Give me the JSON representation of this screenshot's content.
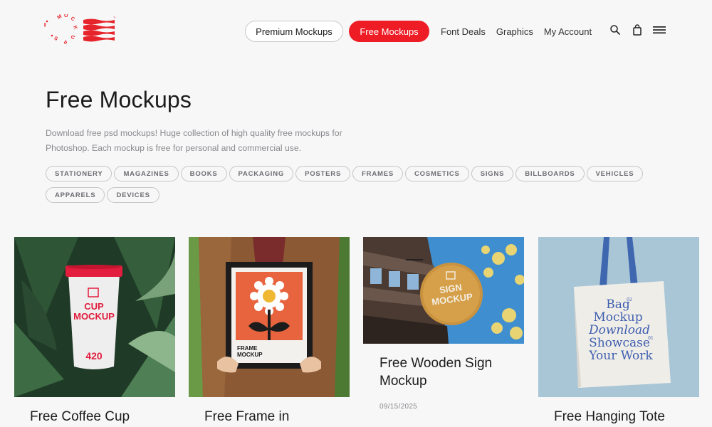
{
  "header": {
    "nav": {
      "premium_label": "Premium Mockups",
      "free_label": "Free Mockups",
      "links": [
        "Font Deals",
        "Graphics",
        "My Account"
      ]
    },
    "icons": [
      "search-icon",
      "shopping-bag-icon",
      "menu-icon"
    ]
  },
  "colors": {
    "accent": "#ee1c25",
    "background": "#f7f7f8",
    "muted_text": "#8a8a8e"
  },
  "intro": {
    "title": "Free Mockups",
    "description": "Download free psd mockups! Huge collection of high quality free mockups for Photoshop. Each mockup is free for personal and commercial use.",
    "tags": [
      "STATIONERY",
      "MAGAZINES",
      "BOOKS",
      "PACKAGING",
      "POSTERS",
      "FRAMES",
      "COSMETICS",
      "SIGNS",
      "BILLBOARDS",
      "VEHICLES",
      "APPARELS",
      "DEVICES"
    ]
  },
  "cards": [
    {
      "title": "Free Coffee Cup",
      "image_text": [
        "CUP",
        "MOCKUP",
        "420"
      ]
    },
    {
      "title": "Free Frame in",
      "image_text": [
        "FRAME",
        "MOCKUP"
      ]
    },
    {
      "title": "Free Wooden Sign Mockup",
      "date": "09/15/2025",
      "image_text": [
        "SIGN",
        "MOCKUP"
      ]
    },
    {
      "title": "Free Hanging Tote",
      "image_text": [
        "Bag",
        "Mockup",
        "Download",
        "Showcase",
        "Your Work",
        "02",
        "01"
      ]
    }
  ]
}
